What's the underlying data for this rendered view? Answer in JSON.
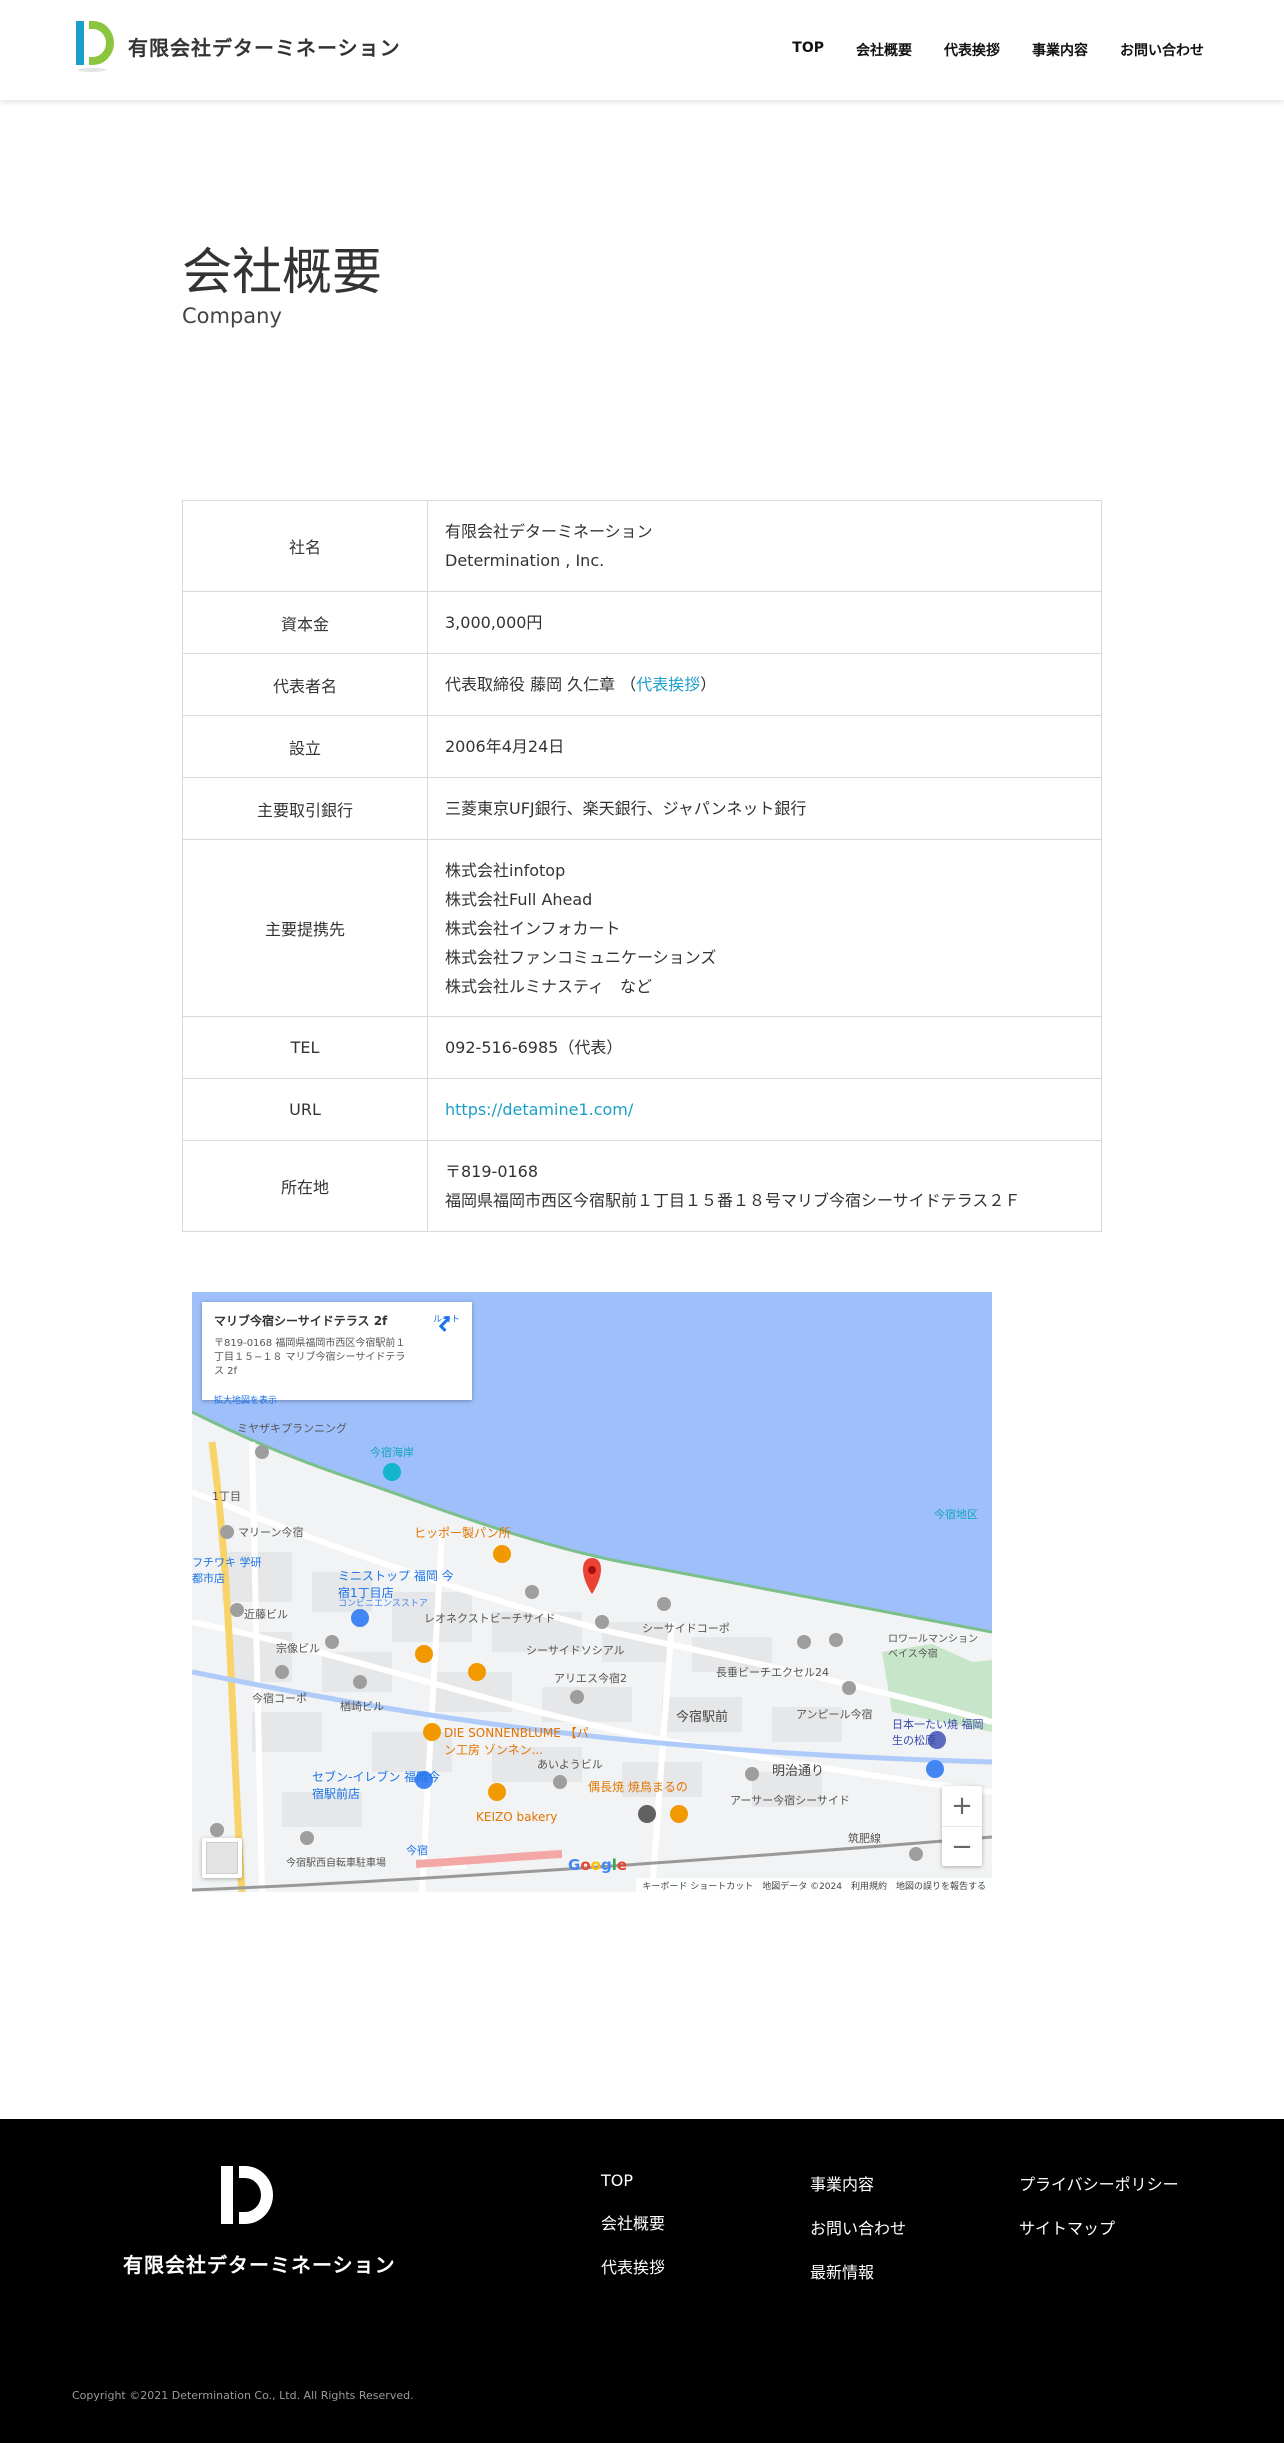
{
  "header": {
    "company_name": "有限会社デターミネーション",
    "nav": [
      "TOP",
      "会社概要",
      "代表挨拶",
      "事業内容",
      "お問い合わせ"
    ]
  },
  "page": {
    "title": "会社概要",
    "subtitle": "Company"
  },
  "table": {
    "rows": [
      {
        "label": "社名",
        "lines": [
          "有限会社デターミネーション",
          "Determination , Inc."
        ]
      },
      {
        "label": "資本金",
        "lines": [
          "3,000,000円"
        ]
      },
      {
        "label": "代表者名",
        "text": "代表取締役 藤岡 久仁章 （",
        "link": "代表挨拶",
        "text_after": "）"
      },
      {
        "label": "設立",
        "lines": [
          "2006年4月24日"
        ]
      },
      {
        "label": "主要取引銀行",
        "lines": [
          "三菱東京UFJ銀行、楽天銀行、ジャパンネット銀行"
        ]
      },
      {
        "label": "主要提携先",
        "lines": [
          "株式会社infotop",
          "株式会社Full Ahead",
          "株式会社インフォカート",
          "株式会社ファンコミュニケーションズ",
          "株式会社ルミナスティ　など"
        ]
      },
      {
        "label": "TEL",
        "lines": [
          "092-516-6985（代表）"
        ]
      },
      {
        "label": "URL",
        "link": "https://detamine1.com/"
      },
      {
        "label": "所在地",
        "lines": [
          "〒819-0168",
          "福岡県福岡市西区今宿駅前１丁目１５番１８号マリブ今宿シーサイドテラス２Ｆ"
        ]
      }
    ]
  },
  "map": {
    "card_title": "マリブ今宿シーサイドテラス 2f",
    "card_address": "〒819-0168 福岡県福岡市西区今宿駅前１丁目１５−１８ マリブ今宿シーサイドテラス 2f",
    "card_link": "拡大地図を表示",
    "directions_label": "ルート",
    "zoom_in": "+",
    "zoom_out": "−",
    "google_logo": "Google",
    "footer_text": "キーボード ショートカット　地図データ ©2024　利用規約　地図の誤りを報告する",
    "labels": [
      "ミヤザキプランニング",
      "今宿海岸",
      "1丁目",
      "マリーン今宿",
      "ヒッポー製パン所",
      "今宿地区",
      "ミニストップ 福岡 今宿1丁目店",
      "コンビニエンスストア",
      "近藤ビル",
      "レオネクストビーチサイド",
      "シーサイドコーポ",
      "宗像ビル",
      "シーサイドソシアル",
      "アリエス今宿2",
      "ロワールマンション ベイス今宿",
      "長垂ビーチエクセル24",
      "今宿コーポ",
      "楢崎ビル",
      "今宿駅前",
      "アンピール今宿",
      "日本一たい焼 福岡生の松原",
      "DIE SONNENBLUME 【パン工房 ゾンネン...",
      "あいようビル",
      "明治通り",
      "セブン-イレブン 福岡今宿駅前店",
      "偶長焼 焼鳥まるの",
      "アーサー今宿シーサイド",
      "KEIZO bakery",
      "筑肥線",
      "今宿駅西自転車駐車場",
      "今宿",
      "フチワキ 学研都市店"
    ]
  },
  "footer": {
    "company_name": "有限会社デターミネーション",
    "col1": [
      "TOP",
      "会社概要",
      "代表挨拶"
    ],
    "col2": [
      "事業内容",
      "お問い合わせ",
      "最新情報"
    ],
    "col3": [
      "プライバシーポリシー",
      "サイトマップ"
    ],
    "copyright": "Copyright ©2021 Determination Co., Ltd. All Rights Reserved."
  },
  "colors": {
    "logo_green": "#8cc63f",
    "logo_blue": "#1aa0c9",
    "link": "#1aa0c9",
    "sea": "#9ebffa",
    "footer_bg": "#000000",
    "marker_red": "#ea4335"
  }
}
